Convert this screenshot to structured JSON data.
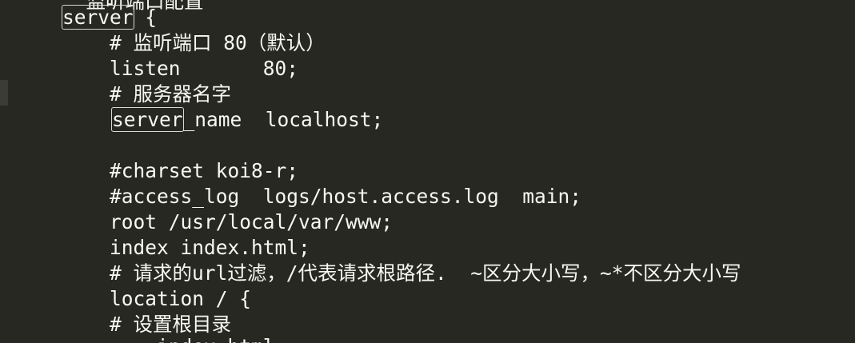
{
  "editor": {
    "lines": [
      "  监听端口配置",
      "server {",
      "    # 监听端口 80（默认）",
      "    listen       80;",
      "    # 服务器名字",
      "    server_name  localhost;",
      "",
      "    #charset koi8-r;",
      "    #access_log  logs/host.access.log  main;",
      "    root /usr/local/var/www;",
      "    index index.html;",
      "    # 请求的url过滤，/代表请求根路径.  ~区分大小写，~*不区分大小写",
      "    location / {",
      "    # 设置根目录",
      "        index.html"
    ],
    "server_keyword": "server",
    "open_brace": " {",
    "server_name_keyword": "server",
    "server_name_suffix": "_name  localhost;"
  },
  "colors": {
    "background": "#272822",
    "text": "#f8f8f2",
    "highlight_box": "#d8d8d0",
    "gutter_mark": "#3b3c35"
  }
}
